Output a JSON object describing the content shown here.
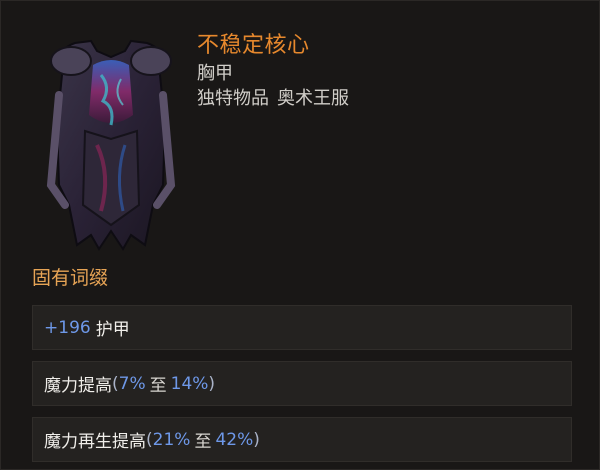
{
  "item": {
    "name": "不稳定核心",
    "slot": "胸甲",
    "rarity": "独特物品",
    "type": "奥术王服"
  },
  "implicit_section": {
    "title": "固有词缀",
    "affixes": [
      {
        "prefix": "+",
        "value": "196",
        "label": "护甲"
      },
      {
        "label": "魔力提高",
        "range_open": "(",
        "min": "7%",
        "to": "至",
        "max": "14%",
        "range_close": ")"
      },
      {
        "label": "魔力再生提高",
        "range_open": "(",
        "min": "21%",
        "to": "至",
        "max": "42%",
        "range_close": ")"
      }
    ]
  },
  "colors": {
    "name": "#e6882d",
    "section_title": "#e7a455",
    "value": "#6e98e8",
    "text": "#f0eeea"
  },
  "icons": {
    "item_art": "chest-armor-robe-icon"
  }
}
